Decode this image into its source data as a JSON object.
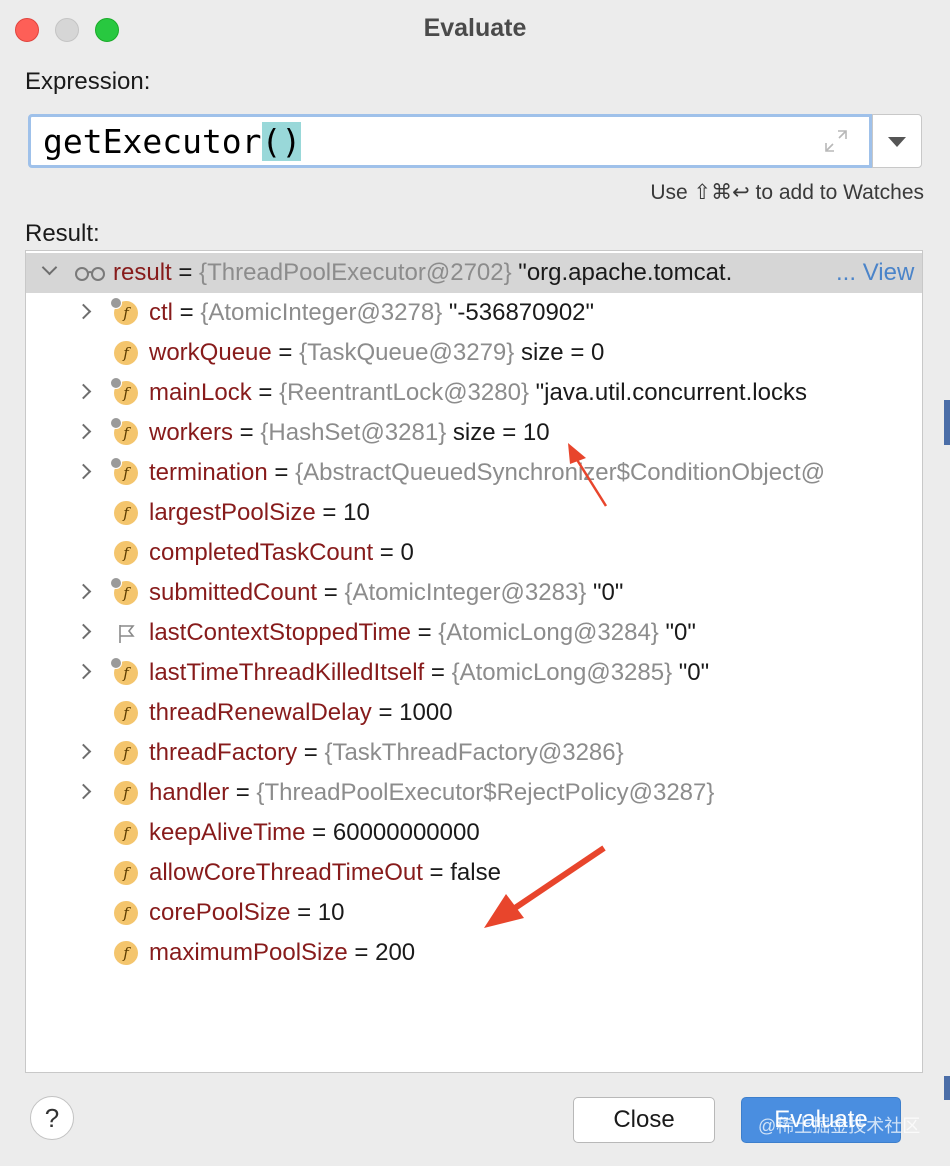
{
  "window": {
    "title": "Evaluate"
  },
  "expression": {
    "label": "Expression:",
    "value_prefix": "getExecutor",
    "value_parens": "()",
    "hint": "Use ⇧⌘↩ to add to Watches"
  },
  "result": {
    "label": "Result:",
    "root": {
      "name": "result",
      "op": " = ",
      "ref": "{ThreadPoolExecutor@2702}",
      "value": " \"org.apache.tomcat.",
      "ellipsis": "...",
      "view": "View"
    },
    "items": [
      {
        "name": "ctl",
        "op": " = ",
        "ref": "{AtomicInteger@3278}",
        "value": " \"-536870902\""
      },
      {
        "name": "workQueue",
        "op": " = ",
        "ref": "{TaskQueue@3279}",
        "value": "  size = 0"
      },
      {
        "name": "mainLock",
        "op": " = ",
        "ref": "{ReentrantLock@3280}",
        "value": " \"java.util.concurrent.locks"
      },
      {
        "name": "workers",
        "op": " = ",
        "ref": "{HashSet@3281}",
        "value": "  size = 10"
      },
      {
        "name": "termination",
        "op": " = ",
        "ref": "{AbstractQueuedSynchronizer$ConditionObject@",
        "value": ""
      },
      {
        "name": "largestPoolSize",
        "op": " = ",
        "ref": "",
        "value": "10"
      },
      {
        "name": "completedTaskCount",
        "op": " = ",
        "ref": "",
        "value": "0"
      },
      {
        "name": "submittedCount",
        "op": " = ",
        "ref": "{AtomicInteger@3283}",
        "value": " \"0\""
      },
      {
        "name": "lastContextStoppedTime",
        "op": " = ",
        "ref": "{AtomicLong@3284}",
        "value": " \"0\""
      },
      {
        "name": "lastTimeThreadKilledItself",
        "op": " = ",
        "ref": "{AtomicLong@3285}",
        "value": " \"0\""
      },
      {
        "name": "threadRenewalDelay",
        "op": " = ",
        "ref": "",
        "value": "1000"
      },
      {
        "name": "threadFactory",
        "op": " = ",
        "ref": "{TaskThreadFactory@3286}",
        "value": ""
      },
      {
        "name": "handler",
        "op": " = ",
        "ref": "{ThreadPoolExecutor$RejectPolicy@3287}",
        "value": ""
      },
      {
        "name": "keepAliveTime",
        "op": " = ",
        "ref": "",
        "value": "60000000000"
      },
      {
        "name": "allowCoreThreadTimeOut",
        "op": " = ",
        "ref": "",
        "value": "false"
      },
      {
        "name": "corePoolSize",
        "op": " = ",
        "ref": "",
        "value": "10"
      },
      {
        "name": "maximumPoolSize",
        "op": " = ",
        "ref": "",
        "value": "200"
      }
    ]
  },
  "buttons": {
    "help": "?",
    "close": "Close",
    "evaluate": "Evaluate"
  },
  "watermark": "@稀土掘金技术社区",
  "colors": {
    "field_name": "#871b1b",
    "reference": "#8c8c8c",
    "field_icon": "#f4c56d",
    "primary_button": "#4a8ee0",
    "annotation_arrow": "#e8452c"
  }
}
